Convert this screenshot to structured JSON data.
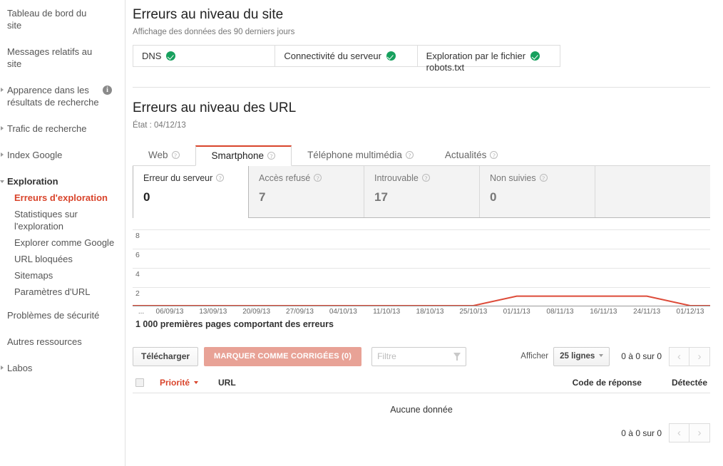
{
  "sidebar": {
    "items": [
      {
        "label": "Tableau de bord du site",
        "arrow": "none",
        "info": false
      },
      {
        "label": "Messages relatifs au site",
        "arrow": "none",
        "info": false
      },
      {
        "label": "Apparence dans les résultats de recherche",
        "arrow": "right",
        "info": true
      },
      {
        "label": "Trafic de recherche",
        "arrow": "right",
        "info": false
      },
      {
        "label": "Index Google",
        "arrow": "right",
        "info": false
      },
      {
        "label": "Exploration",
        "arrow": "down",
        "info": false
      }
    ],
    "sub_items": [
      {
        "label": "Erreurs d'exploration",
        "active": true
      },
      {
        "label": "Statistiques sur l'exploration",
        "active": false
      },
      {
        "label": "Explorer comme Google",
        "active": false
      },
      {
        "label": "URL bloquées",
        "active": false
      },
      {
        "label": "Sitemaps",
        "active": false
      },
      {
        "label": "Paramètres d'URL",
        "active": false
      }
    ],
    "tail_items": [
      {
        "label": "Problèmes de sécurité",
        "arrow": "none"
      },
      {
        "label": "Autres ressources",
        "arrow": "none"
      },
      {
        "label": "Labos",
        "arrow": "right"
      }
    ]
  },
  "site_errors": {
    "title": "Erreurs au niveau du site",
    "subtitle": "Affichage des données des 90 derniers jours",
    "cells": [
      {
        "label": "DNS",
        "overflow": "",
        "status": "ok"
      },
      {
        "label": "Connectivité du serveur",
        "overflow": "",
        "status": "ok"
      },
      {
        "label": "Exploration par le fichier",
        "overflow": "robots.txt",
        "status": "ok"
      }
    ]
  },
  "url_errors": {
    "title": "Erreurs au niveau des URL",
    "state_label": "État : 04/12/13",
    "tabs": [
      {
        "label": "Web",
        "active": false
      },
      {
        "label": "Smartphone",
        "active": true
      },
      {
        "label": "Téléphone multimédia",
        "active": false
      },
      {
        "label": "Actualités",
        "active": false
      }
    ],
    "metrics": [
      {
        "label": "Erreur du serveur",
        "value": "0",
        "active": true,
        "help": true
      },
      {
        "label": "Accès refusé",
        "value": "7",
        "active": false,
        "help": true
      },
      {
        "label": "Introuvable",
        "value": "17",
        "active": false,
        "help": true
      },
      {
        "label": "Non suivies",
        "value": "0",
        "active": false,
        "help": true
      },
      {
        "label": "",
        "value": "",
        "active": false,
        "help": false
      }
    ]
  },
  "chart_data": {
    "type": "line",
    "title": "1 000 premières pages comportant des erreurs",
    "xlabel": "",
    "ylabel": "",
    "ylim": [
      0,
      9
    ],
    "yticks": [
      2,
      4,
      6,
      8
    ],
    "grid": true,
    "legend": false,
    "line_color": "#dd4b39",
    "leading_ellipsis": "...",
    "categories": [
      "06/09/13",
      "13/09/13",
      "20/09/13",
      "27/09/13",
      "04/10/13",
      "11/10/13",
      "18/10/13",
      "25/10/13",
      "01/11/13",
      "08/11/13",
      "16/11/13",
      "24/11/13",
      "01/12/13"
    ],
    "series": [
      {
        "name": "Erreur du serveur",
        "values": [
          0,
          0,
          0,
          0,
          0,
          0,
          0,
          0,
          1,
          1,
          1,
          1,
          0
        ]
      }
    ]
  },
  "toolbar": {
    "download_label": "Télécharger",
    "mark_fixed_label": "MARQUER COMME CORRIGÉES (0)",
    "filter_placeholder": "Filtre",
    "filter_value": "",
    "show_label": "Afficher",
    "rows_value": "25 lignes",
    "range_text": "0 à 0 sur 0",
    "prev_icon": "‹",
    "next_icon": "›"
  },
  "table": {
    "columns": {
      "priority": "Priorité",
      "url": "URL",
      "response_code": "Code de réponse",
      "detected": "Détectée"
    },
    "empty_message": "Aucune donnée",
    "bottom_range_text": "0 à 0 sur 0",
    "prev_icon": "‹",
    "next_icon": "›"
  }
}
